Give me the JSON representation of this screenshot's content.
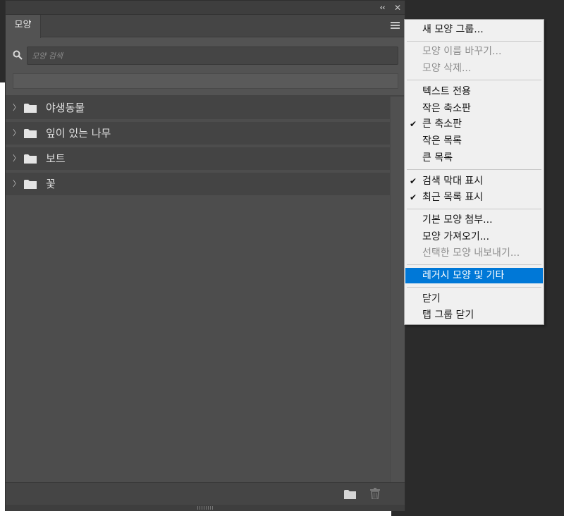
{
  "panel": {
    "tab_label": "모양",
    "search_placeholder": "모양 검색",
    "items": [
      {
        "label": "야생동물"
      },
      {
        "label": "잎이 있는 나무"
      },
      {
        "label": "보트"
      },
      {
        "label": "꽃"
      }
    ]
  },
  "menu": {
    "new_group": "새 모양 그룹...",
    "rename": "모양 이름 바꾸기...",
    "delete": "모양 삭제...",
    "text_only": "텍스트 전용",
    "small_thumbnail": "작은 축소판",
    "large_thumbnail": "큰 축소판",
    "small_list": "작은 목록",
    "large_list": "큰 목록",
    "show_search_bar": "검색 막대 표시",
    "show_recent": "최근 목록 표시",
    "append_default": "기본 모양 첨부...",
    "import": "모양 가져오기...",
    "export_selected": "선택한 모양 내보내기...",
    "legacy": "레거시 모양 및 기타",
    "close": "닫기",
    "close_tab_group": "탭 그룹 닫기"
  },
  "colors": {
    "highlight": "#0078d7",
    "panel_bg": "#535353"
  }
}
